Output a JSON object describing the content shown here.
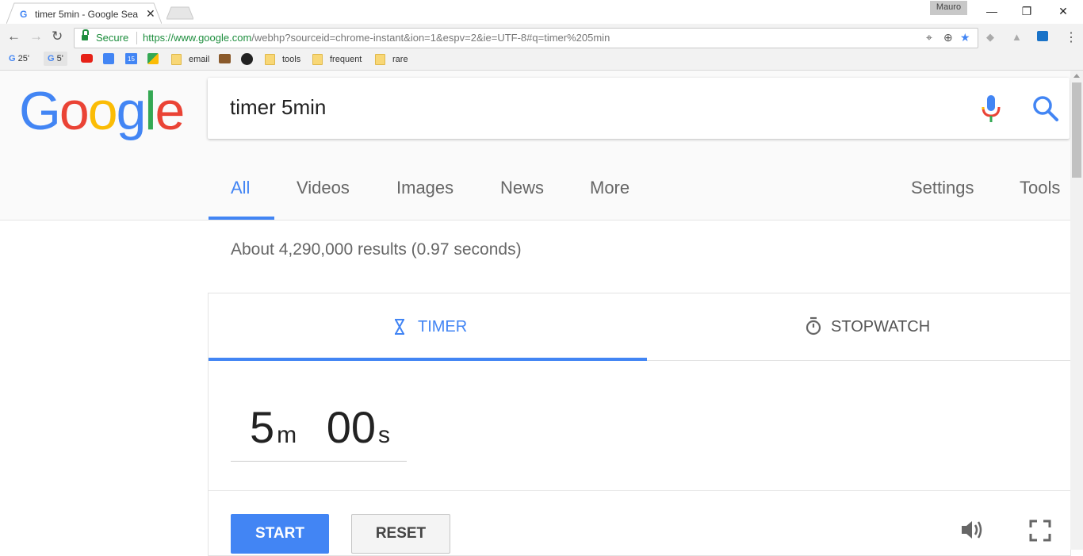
{
  "browser": {
    "tab_favicon": "G",
    "tab_title": "timer 5min - Google Sea",
    "profile_name": "Mauro",
    "secure_label": "Secure",
    "url_host": "https://www.google.com",
    "url_rest": "/webhp?sourceid=chrome-instant&ion=1&espv=2&ie=UTF-8#q=timer%205min",
    "bookmarks": [
      {
        "icon": "google-icon",
        "label": "25'"
      },
      {
        "icon": "google-icon",
        "label": "5'"
      },
      {
        "icon": "youtube-icon",
        "label": ""
      },
      {
        "icon": "contacts-icon",
        "label": ""
      },
      {
        "icon": "calendar-icon",
        "label": "15"
      },
      {
        "icon": "maps-icon",
        "label": ""
      },
      {
        "icon": "folder-icon",
        "label": "email"
      },
      {
        "icon": "bag-icon",
        "label": ""
      },
      {
        "icon": "github-icon",
        "label": ""
      },
      {
        "icon": "folder-icon",
        "label": "tools"
      },
      {
        "icon": "folder-icon",
        "label": "frequent"
      },
      {
        "icon": "folder-icon",
        "label": "rare"
      }
    ]
  },
  "google": {
    "logo_letters": [
      "G",
      "o",
      "o",
      "g",
      "l",
      "e"
    ],
    "logo_colors": [
      "#4285f4",
      "#ea4335",
      "#fbbc05",
      "#4285f4",
      "#34a853",
      "#ea4335"
    ],
    "query": "timer 5min",
    "tabs": [
      "All",
      "Videos",
      "Images",
      "News",
      "More"
    ],
    "right_tabs": [
      "Settings",
      "Tools"
    ],
    "active_tab": "All",
    "stats": "About 4,290,000 results (0.97 seconds)"
  },
  "timer": {
    "tab_timer": "TIMER",
    "tab_stopwatch": "STOPWATCH",
    "minutes": "5",
    "minutes_unit": "m",
    "seconds": "00",
    "seconds_unit": "s",
    "start_label": "START",
    "reset_label": "RESET"
  },
  "colors": {
    "accent": "#4285f4",
    "secure_green": "#1e8e3e"
  }
}
